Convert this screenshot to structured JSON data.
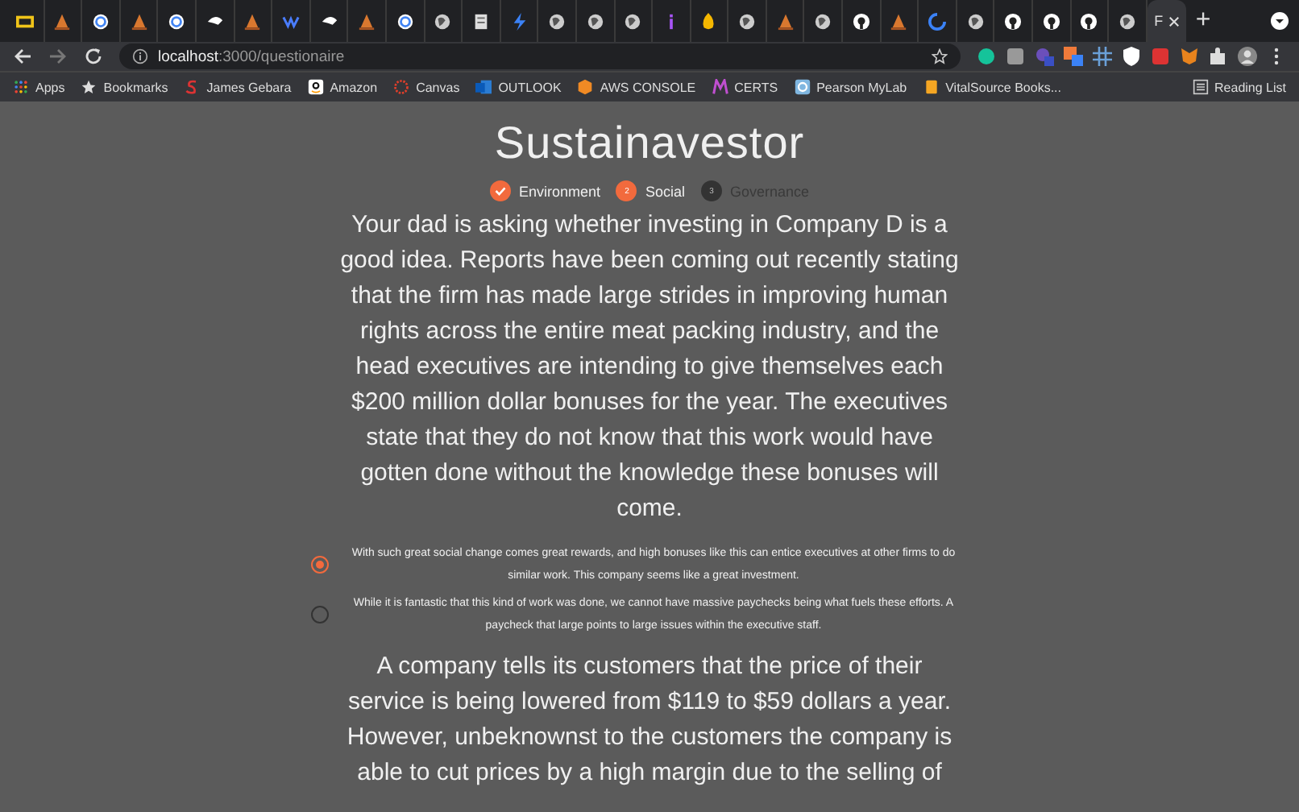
{
  "browser": {
    "tabs": [
      {
        "kind": "lc",
        "selected": false
      },
      {
        "kind": "sail",
        "selected": false
      },
      {
        "kind": "google",
        "selected": false
      },
      {
        "kind": "sail",
        "selected": false
      },
      {
        "kind": "google",
        "selected": false
      },
      {
        "kind": "hand",
        "selected": false
      },
      {
        "kind": "sail",
        "selected": false
      },
      {
        "kind": "squiggle",
        "selected": false
      },
      {
        "kind": "hand",
        "selected": false
      },
      {
        "kind": "sail",
        "selected": false
      },
      {
        "kind": "google",
        "selected": false
      },
      {
        "kind": "globe",
        "selected": false
      },
      {
        "kind": "doc",
        "selected": false
      },
      {
        "kind": "bolt",
        "selected": false
      },
      {
        "kind": "globe",
        "selected": false
      },
      {
        "kind": "globe",
        "selected": false
      },
      {
        "kind": "globe",
        "selected": false
      },
      {
        "kind": "info",
        "selected": false
      },
      {
        "kind": "flame",
        "selected": false
      },
      {
        "kind": "globe",
        "selected": false
      },
      {
        "kind": "sail",
        "selected": false
      },
      {
        "kind": "globe",
        "selected": false
      },
      {
        "kind": "github",
        "selected": false
      },
      {
        "kind": "sail",
        "selected": false
      },
      {
        "kind": "spinner",
        "selected": false
      },
      {
        "kind": "globe",
        "selected": false
      },
      {
        "kind": "github",
        "selected": false
      },
      {
        "kind": "github",
        "selected": false
      },
      {
        "kind": "github",
        "selected": false
      },
      {
        "kind": "globe",
        "selected": false
      },
      {
        "kind": "text",
        "title": "F",
        "selected": true
      }
    ],
    "new_tab": "+",
    "url": {
      "host": "localhost",
      "path": ":3000/questionaire"
    },
    "bookmarks": [
      {
        "kind": "apps",
        "label": "Apps"
      },
      {
        "kind": "star",
        "label": "Bookmarks"
      },
      {
        "kind": "s",
        "label": "James Gebara"
      },
      {
        "kind": "a",
        "label": "Amazon"
      },
      {
        "kind": "ring",
        "label": "Canvas"
      },
      {
        "kind": "outlook",
        "label": "OUTLOOK"
      },
      {
        "kind": "cube",
        "label": "AWS CONSOLE"
      },
      {
        "kind": "m",
        "label": "CERTS"
      },
      {
        "kind": "p",
        "label": "Pearson MyLab"
      },
      {
        "kind": "book",
        "label": "VitalSource Books..."
      }
    ],
    "reading_list": "Reading List"
  },
  "page": {
    "title": "Sustainavestor",
    "steps": [
      {
        "label": "Environment",
        "kind": "done"
      },
      {
        "label": "Social",
        "number": "2",
        "kind": "active"
      },
      {
        "label": "Governance",
        "number": "3",
        "kind": "pending"
      }
    ],
    "questions": [
      {
        "text": "Your dad is asking whether investing in Company D is a good idea. Reports have been coming out recently stating that the firm has made large strides in improving human rights across the entire meat packing industry, and the head executives are intending to give themselves each $200 million dollar bonuses for the year. The executives state that they do not know that this work would have gotten done without the knowledge these bonuses will come.",
        "options": [
          {
            "text": "With such great social change comes great rewards, and high bonuses like this can entice executives at other firms to do similar work. This company seems like a great investment.",
            "selected": true
          },
          {
            "text": "While it is fantastic that this kind of work was done, we cannot have massive paychecks being what fuels these efforts. A paycheck that large points to large issues within the executive staff.",
            "selected": false
          }
        ]
      },
      {
        "text": "A company tells its customers that the price of their service is being lowered from $119 to $59 dollars a year. However, unbeknownst to the customers the company is able to cut prices by a high margin due to the selling of"
      }
    ]
  }
}
